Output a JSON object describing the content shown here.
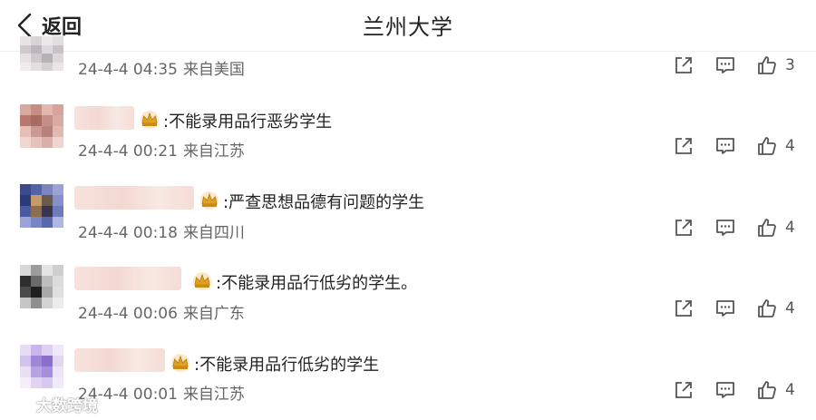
{
  "header": {
    "back_label": "返回",
    "title": "兰州大学"
  },
  "comments": [
    {
      "text": "",
      "date": "24-4-4 04:35",
      "location": "来自美国",
      "likes": "3"
    },
    {
      "text": ":不能录用品行恶劣学生",
      "date": "24-4-4 00:21",
      "location": "来自江苏",
      "likes": "4"
    },
    {
      "text": ":严查思想品德有问题的学生",
      "date": "24-4-4 00:18",
      "location": "来自四川",
      "likes": "4"
    },
    {
      "text": ":不能录用品行低劣的学生。",
      "date": "24-4-4 00:06",
      "location": "来自广东",
      "likes": "4"
    },
    {
      "text": ":不能录用品行低劣的学生",
      "date": "24-4-4 00:01",
      "location": "来自江苏",
      "likes": "4"
    }
  ],
  "icons": {
    "share": "share-icon",
    "comment": "comment-icon",
    "like": "like-icon",
    "crown": "crown-badge-icon",
    "back": "chevron-left-icon"
  },
  "colors": {
    "icon": "#555555",
    "crown": "#e0a020"
  },
  "watermark": {
    "text": "大数跨境"
  }
}
